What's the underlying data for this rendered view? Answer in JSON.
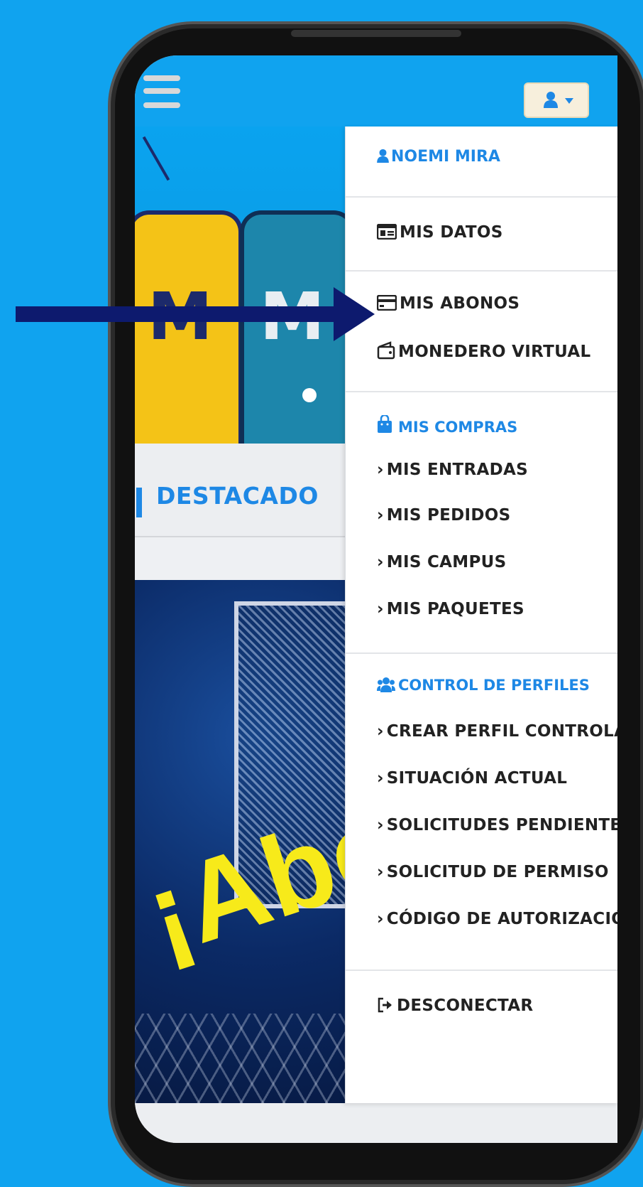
{
  "colors": {
    "accent": "#1e88e5",
    "background": "#10a3ef",
    "arrow": "#0d1a6e",
    "promo_text": "#f7ea1a"
  },
  "header": {
    "menu_icon": "hamburger-icon",
    "user_icon": "user-icon"
  },
  "main": {
    "section_title": "DESTACADO",
    "promo_text": "¡Abó"
  },
  "menu": {
    "user_name": "NOEMI MIRA",
    "mis_datos": "MIS DATOS",
    "mis_abonos": "MIS ABONOS",
    "monedero": "MONEDERO VIRTUAL",
    "compras_header": "MIS COMPRAS",
    "compras": [
      "MIS ENTRADAS",
      "MIS PEDIDOS",
      "MIS CAMPUS",
      "MIS PAQUETES"
    ],
    "perfiles_header": "CONTROL DE PERFILES",
    "perfiles": [
      "CREAR PERFIL CONTROLADO",
      "SITUACIÓN ACTUAL",
      "SOLICITUDES PENDIENTES",
      "SOLICITUD DE PERMISO",
      "CÓDIGO DE AUTORIZACIÓN"
    ],
    "logout": "DESCONECTAR"
  }
}
